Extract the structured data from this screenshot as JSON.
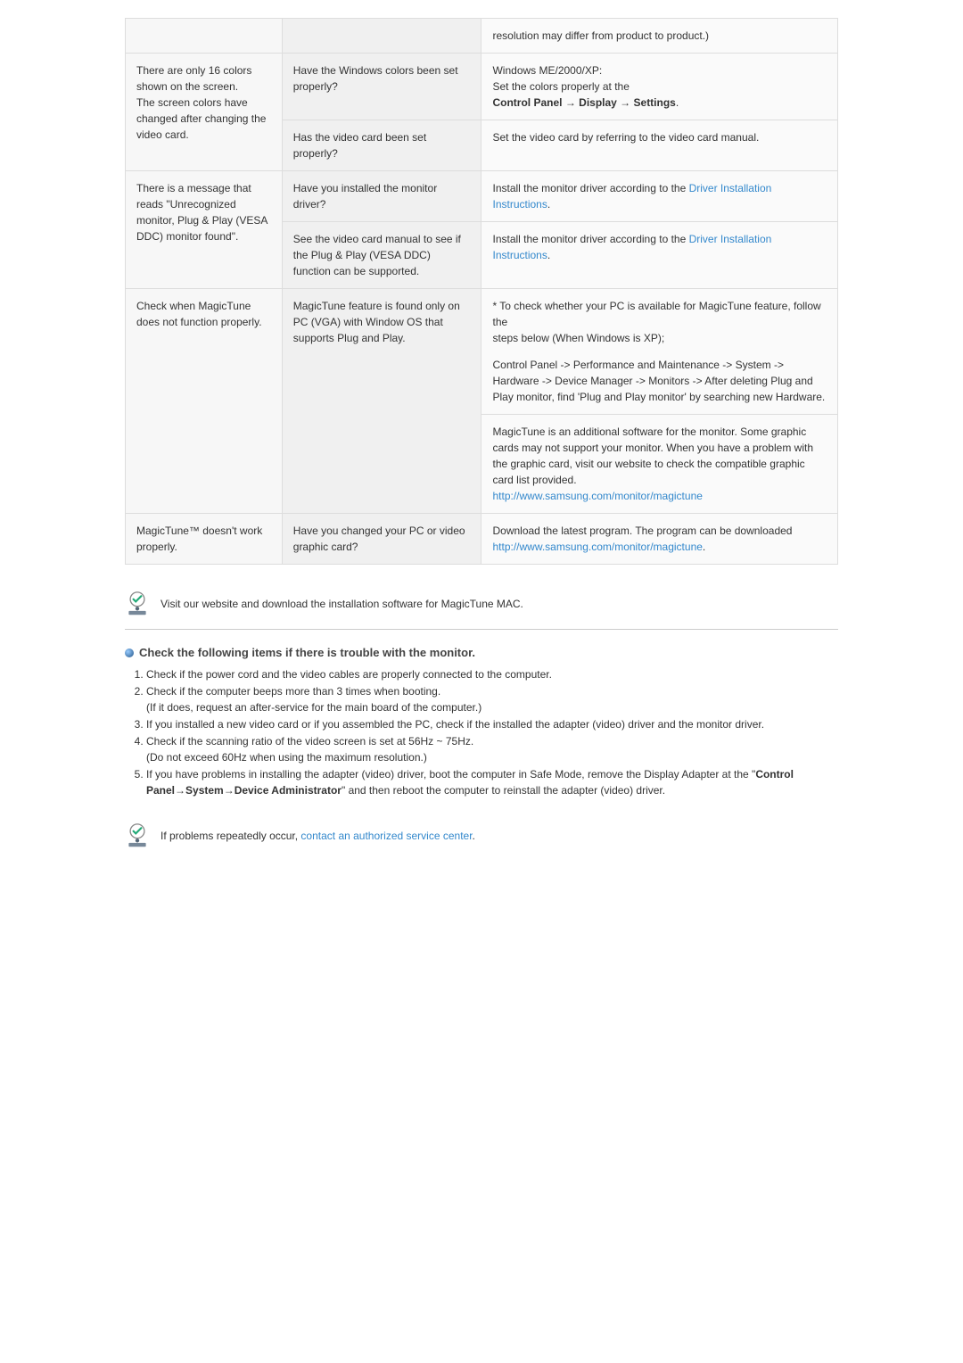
{
  "table": {
    "rows": [
      {
        "c1": "",
        "c2": "",
        "c3": "resolution may differ from product to product.)"
      },
      {
        "c1": "There are only 16 colors shown on the screen.\nThe screen colors have changed after changing the video card.",
        "c2": "Have the Windows colors been set properly?",
        "c3_pre": "Windows ME/2000/XP:\nSet the colors properly at the\n",
        "c3_bold": "Control Panel → Display → Settings",
        "c3_post": "."
      },
      {
        "c1": "",
        "c2": "Has the video card been set properly?",
        "c3": "Set the video card by referring to the video card manual."
      },
      {
        "c1": "There is a message that reads \"Unrecognized monitor, Plug & Play (VESA DDC) monitor found\".",
        "c2": "Have you installed the monitor driver?",
        "c3_pre": "Install the monitor driver according to the ",
        "c3_link": "Driver Installation Instructions",
        "c3_post": "."
      },
      {
        "c1": "",
        "c2": "See the video card manual to see if the Plug & Play (VESA DDC) function can be supported.",
        "c3_pre": "Install the monitor driver according to the ",
        "c3_link": "Driver Installation Instructions",
        "c3_post": "."
      },
      {
        "c1": "Check when MagicTune does not function properly.",
        "c2": "MagicTune feature is found only on PC (VGA) with Window OS that supports Plug and Play.",
        "c3_block1": "* To check whether your PC is available for MagicTune feature, follow the\n    steps below (When Windows is XP);",
        "c3_block2": "Control Panel -> Performance and Maintenance -> System -> Hardware -> Device Manager -> Monitors -> After deleting Plug and Play monitor, find 'Plug and Play monitor' by searching new Hardware."
      },
      {
        "c1": "",
        "c2": "",
        "c3_pre": "MagicTune is an additional software for the monitor. Some graphic cards may not support your monitor. When you have a problem with the graphic card, visit our website to check the compatible graphic card list provided.\n",
        "c3_link": "http://www.samsung.com/monitor/magictune"
      },
      {
        "c1": "MagicTune™ doesn't work properly.",
        "c2": "Have you changed your PC or video graphic card?",
        "c3_pre": "Download the latest program. The program can be downloaded\n",
        "c3_link": "http://www.samsung.com/monitor/magictune",
        "c3_post": "."
      }
    ]
  },
  "note1": "Visit our website and download the installation software for MagicTune MAC.",
  "check_heading": "Check the following items if there is trouble with the monitor.",
  "list": [
    {
      "t": "Check if the power cord and the video cables are properly connected to the computer."
    },
    {
      "t": "Check if the computer beeps more than 3 times when booting.\n(If it does, request an after-service for the main board of the computer.)"
    },
    {
      "t": "If you installed a new video card or if you assembled the PC, check if the installed the adapter (video) driver and the monitor driver."
    },
    {
      "t": "Check if the scanning ratio of the video screen is set at 56Hz ~ 75Hz.\n(Do not exceed 60Hz when using the maximum resolution.)"
    },
    {
      "pre": "If you have problems in installing the adapter (video) driver, boot the computer in Safe Mode, remove the Display Adapter at the \"",
      "bold": "Control Panel→System→Device Administrator",
      "post": "\" and then reboot the computer to reinstall the adapter (video) driver."
    }
  ],
  "note2_pre": "If problems repeatedly occur, ",
  "note2_link": "contact an authorized service center",
  "note2_post": "."
}
